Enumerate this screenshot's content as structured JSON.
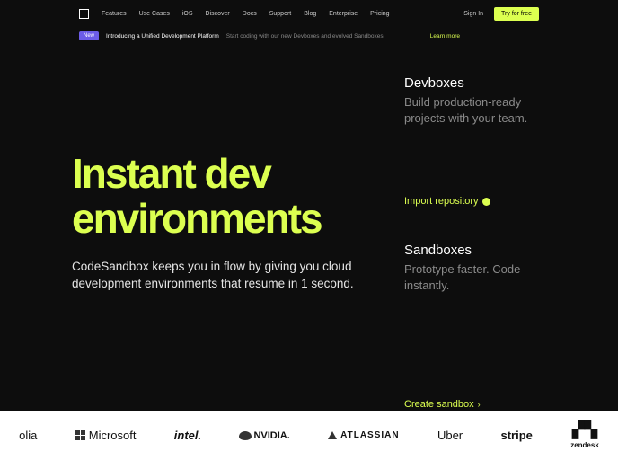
{
  "nav": {
    "items": [
      "Features",
      "Use Cases",
      "iOS",
      "Discover",
      "Docs",
      "Support",
      "Blog",
      "Enterprise",
      "Pricing"
    ]
  },
  "header": {
    "signin": "Sign In",
    "try_free": "Try for free"
  },
  "banner": {
    "badge": "New",
    "headline": "Introducing a Unified Development Platform",
    "sub": "Start coding with our new Devboxes and evolved Sandboxes.",
    "learn_more": "Learn more"
  },
  "hero": {
    "title_l1": "Instant dev",
    "title_l2": "environments",
    "sub": "CodeSandbox keeps you in flow by giving you cloud development environments that resume in 1 second."
  },
  "devboxes": {
    "title": "Devboxes",
    "desc": "Build production-ready projects with your team.",
    "link": "Import repository"
  },
  "sandboxes": {
    "title": "Sandboxes",
    "desc": "Prototype faster. Code instantly.",
    "link": "Create sandbox"
  },
  "logos": {
    "algolia": "olia",
    "microsoft": "Microsoft",
    "intel": "intel.",
    "nvidia": "NVIDIA.",
    "atlassian": "ATLASSIAN",
    "uber": "Uber",
    "stripe": "stripe",
    "zendesk": "zendesk"
  }
}
